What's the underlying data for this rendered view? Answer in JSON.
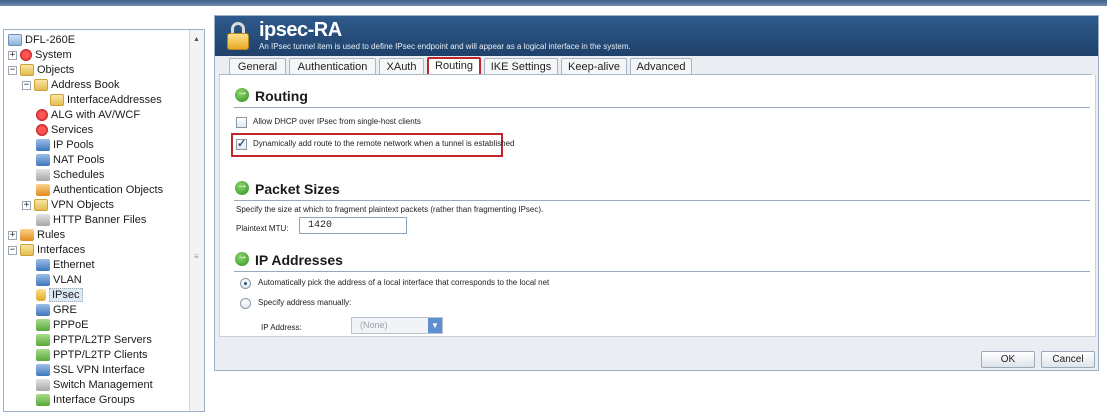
{
  "sidebar": {
    "items": [
      {
        "label": "DFL-260E",
        "icon": "device-icon"
      },
      {
        "label": "System",
        "icon": "system-icon"
      },
      {
        "label": "Objects",
        "icon": "folder-icon"
      },
      {
        "label": "Address Book",
        "icon": "address-book-icon"
      },
      {
        "label": "InterfaceAddresses",
        "icon": "folder-icon"
      },
      {
        "label": "ALG with AV/WCF",
        "icon": "alg-icon"
      },
      {
        "label": "Services",
        "icon": "services-icon"
      },
      {
        "label": "IP Pools",
        "icon": "ip-pools-icon"
      },
      {
        "label": "NAT Pools",
        "icon": "nat-pools-icon"
      },
      {
        "label": "Schedules",
        "icon": "schedules-icon"
      },
      {
        "label": "Authentication Objects",
        "icon": "authentication-icon"
      },
      {
        "label": "VPN Objects",
        "icon": "folder-icon"
      },
      {
        "label": "HTTP Banner Files",
        "icon": "banner-files-icon"
      },
      {
        "label": "Rules",
        "icon": "rules-icon"
      },
      {
        "label": "Interfaces",
        "icon": "folder-icon"
      },
      {
        "label": "Ethernet",
        "icon": "ethernet-icon"
      },
      {
        "label": "VLAN",
        "icon": "vlan-icon"
      },
      {
        "label": "IPsec",
        "icon": "lock-icon"
      },
      {
        "label": "GRE",
        "icon": "gre-icon"
      },
      {
        "label": "PPPoE",
        "icon": "pppoe-icon"
      },
      {
        "label": "PPTP/L2TP Servers",
        "icon": "pptp-server-icon"
      },
      {
        "label": "PPTP/L2TP Clients",
        "icon": "pptp-client-icon"
      },
      {
        "label": "SSL VPN Interface",
        "icon": "ssl-vpn-icon"
      },
      {
        "label": "Switch Management",
        "icon": "switch-icon"
      },
      {
        "label": "Interface Groups",
        "icon": "interface-groups-icon"
      }
    ]
  },
  "header": {
    "title": "ipsec-RA",
    "subtitle": "An IPsec tunnel item is used to define IPsec endpoint and will appear as a logical interface in the system."
  },
  "tabs": [
    {
      "label": "General"
    },
    {
      "label": "Authentication"
    },
    {
      "label": "XAuth"
    },
    {
      "label": "Routing"
    },
    {
      "label": "IKE Settings"
    },
    {
      "label": "Keep-alive"
    },
    {
      "label": "Advanced"
    }
  ],
  "routing": {
    "title": "Routing",
    "dhcp_label": "Allow DHCP over IPsec from single-host clients",
    "dhcp_checked": false,
    "dynamic_route_label": "Dynamically add route to the remote network when a tunnel is established",
    "dynamic_route_checked": true
  },
  "packet_sizes": {
    "title": "Packet Sizes",
    "description": "Specify the size at which to fragment plaintext packets (rather than fragmenting IPsec).",
    "mtu_label": "Plaintext MTU:",
    "mtu_value": "1420"
  },
  "ip_addresses": {
    "title": "IP Addresses",
    "auto_label": "Automatically pick the address of a local interface that corresponds to the local net",
    "manual_label": "Specify address manually:",
    "ip_label": "IP Address:",
    "ip_value": "(None)"
  },
  "buttons": {
    "ok": "OK",
    "cancel": "Cancel"
  },
  "colors": {
    "accent_red": "#c0272d",
    "header_blue": "#2e5a8c"
  }
}
